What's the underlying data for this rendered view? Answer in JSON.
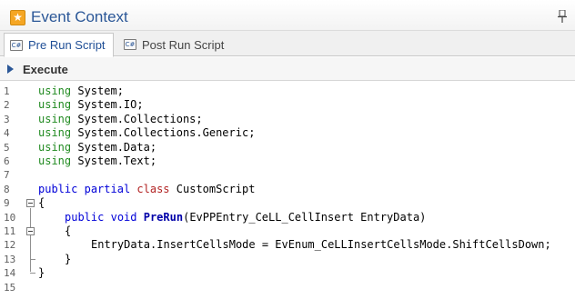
{
  "window": {
    "title": "Event Context",
    "title_icon": "star-icon",
    "pin_icon": "pin-icon"
  },
  "tabs": [
    {
      "label": "Pre Run Script",
      "icon": "csharp-file-icon",
      "active": true
    },
    {
      "label": "Post Run Script",
      "icon": "csharp-file-icon",
      "active": false
    }
  ],
  "toolbar": {
    "execute_label": "Execute",
    "execute_icon": "play-icon"
  },
  "editor": {
    "line_numbers": [
      "1",
      "2",
      "3",
      "4",
      "5",
      "6",
      "7",
      "8",
      "9",
      "10",
      "11",
      "12",
      "13",
      "14",
      "15"
    ],
    "lines": [
      {
        "kw": "using",
        "rest": " System;"
      },
      {
        "kw": "using",
        "rest": " System.IO;"
      },
      {
        "kw": "using",
        "rest": " System.Collections;"
      },
      {
        "kw": "using",
        "rest": " System.Collections.Generic;"
      },
      {
        "kw": "using",
        "rest": " System.Data;"
      },
      {
        "kw": "using",
        "rest": " System.Text;"
      },
      {
        "text": ""
      },
      {
        "kw1": "public",
        "kw2": "partial",
        "kw3": "class",
        "name": "CustomScript"
      },
      {
        "text": "{"
      },
      {
        "kw1": "public",
        "kw2": "void",
        "method": "PreRun",
        "params": "(EvPPEntry_CeLL_CellInsert EntryData)"
      },
      {
        "text": "{"
      },
      {
        "text": "EntryData.InsertCellsMode = EvEnum_CeLLInsertCellsMode.ShiftCellsDown;"
      },
      {
        "text": "}"
      },
      {
        "text": "}"
      },
      {
        "text": ""
      }
    ]
  },
  "colors": {
    "title": "#2b5797",
    "keyword_using": "#228b22",
    "keyword_blue": "#0000d8",
    "keyword_class": "#b22222",
    "method": "#0000a8"
  }
}
